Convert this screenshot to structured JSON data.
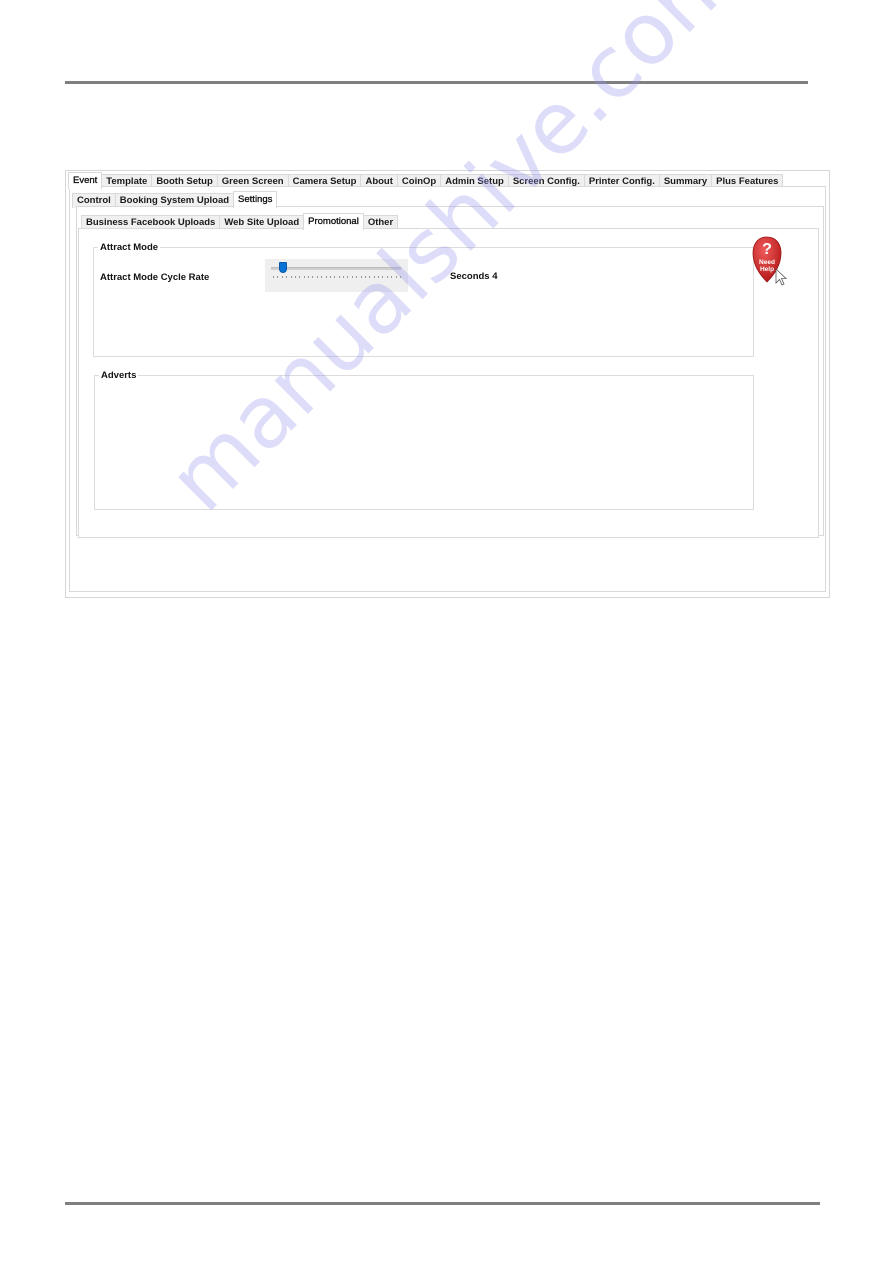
{
  "main_tabs": [
    {
      "label": "Event",
      "active": true
    },
    {
      "label": "Template"
    },
    {
      "label": "Booth Setup"
    },
    {
      "label": "Green Screen"
    },
    {
      "label": "Camera Setup"
    },
    {
      "label": "About"
    },
    {
      "label": "CoinOp"
    },
    {
      "label": "Admin Setup"
    },
    {
      "label": "Screen Config."
    },
    {
      "label": "Printer Config."
    },
    {
      "label": "Summary"
    },
    {
      "label": "Plus Features"
    }
  ],
  "sub_tabs": [
    {
      "label": "Control"
    },
    {
      "label": "Booking System Upload"
    },
    {
      "label": "Settings",
      "active": true
    }
  ],
  "settings_tabs": [
    {
      "label": "Business Facebook Uploads"
    },
    {
      "label": "Web Site Upload"
    },
    {
      "label": "Promotional",
      "active": true
    },
    {
      "label": "Other"
    }
  ],
  "attract_mode": {
    "group_title": "Attract Mode",
    "cycle_rate_label": "Attract Mode Cycle Rate",
    "slider": {
      "value": 4,
      "min": 4,
      "max": 60,
      "fraction": 0.0,
      "tick_count": 30
    },
    "value_text": "Seconds 4"
  },
  "adverts": {
    "group_title": "Adverts"
  },
  "help": {
    "line1": "Need",
    "line2": "Help",
    "color": "#d42a2a"
  },
  "colors": {
    "slider_thumb": "#0a72d6",
    "rule": "#7f7f7f"
  },
  "watermark": "manualshive.com"
}
